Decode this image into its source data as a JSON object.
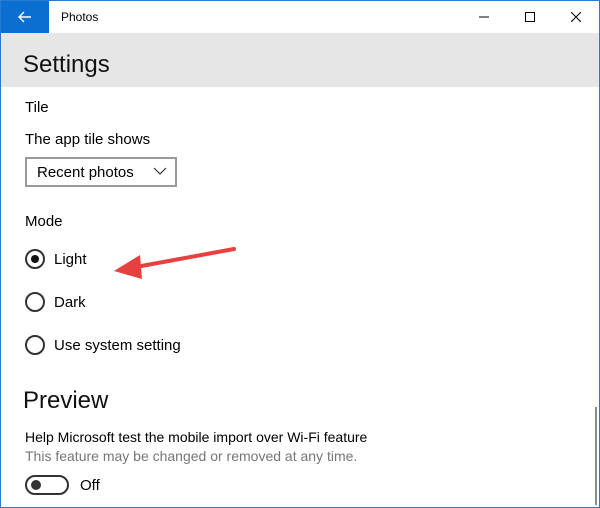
{
  "window": {
    "title": "Photos"
  },
  "header": {
    "title": "Settings"
  },
  "tile": {
    "section_label": "Tile",
    "field_label": "The app tile shows",
    "selected_value": "Recent photos"
  },
  "mode": {
    "section_label": "Mode",
    "options": [
      {
        "label": "Light",
        "checked": true
      },
      {
        "label": "Dark",
        "checked": false
      },
      {
        "label": "Use system setting",
        "checked": false
      }
    ]
  },
  "preview": {
    "title": "Preview",
    "help_text": "Help Microsoft test the mobile import over Wi-Fi feature",
    "sub_text": "This feature may be changed or removed at any time.",
    "toggle_state": "Off"
  },
  "colors": {
    "accent": "#0a6fd1",
    "header_bg": "#e6e6e6",
    "annotation_arrow": "#e8403f"
  },
  "icons": {
    "back": "back-arrow-icon",
    "minimize": "minimize-icon",
    "maximize": "maximize-icon",
    "close": "close-icon",
    "dropdown": "chevron-down-icon"
  }
}
